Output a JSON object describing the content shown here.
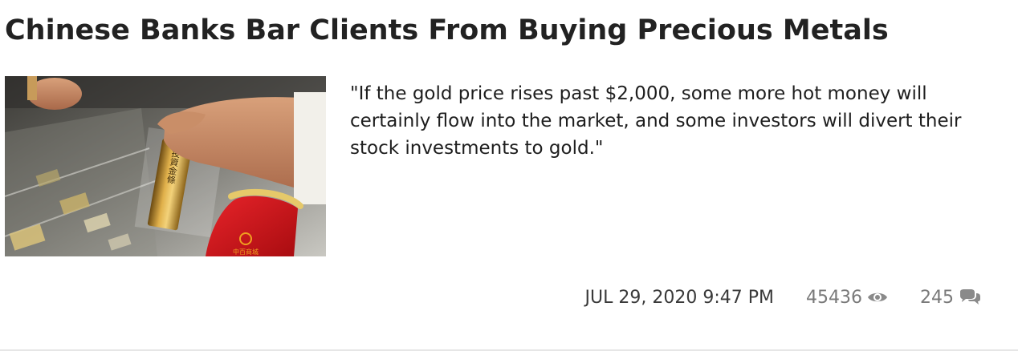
{
  "article": {
    "title": "Chinese Banks Bar Clients From Buying Precious Metals",
    "excerpt": "\"If the gold price rises past $2,000, some more hot money will certainly flow into the market, and some investors will divert their stock investments to gold.\"",
    "image": {
      "bar_inscription": "投資金條",
      "pouch_print": "中百商城"
    },
    "meta": {
      "date": "JUL 29, 2020 9:47 PM",
      "views": "45436",
      "views_icon": "eye-icon",
      "comments": "245",
      "comments_icon": "comments-icon"
    }
  },
  "colors": {
    "title": "#222222",
    "body_text": "#1e1e1e",
    "meta_muted": "#7a7a7a",
    "pouch_red": "#d0141a",
    "gold": "#c89a38"
  }
}
